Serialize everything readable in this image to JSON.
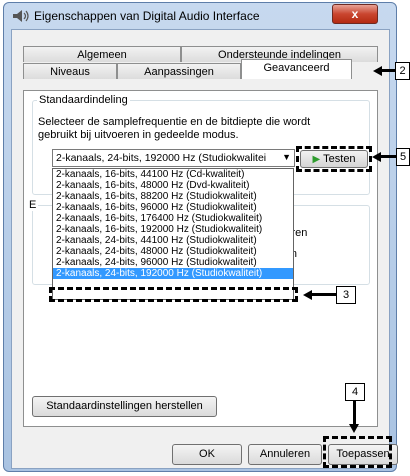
{
  "window": {
    "title": "Eigenschappen van Digital Audio Interface",
    "close_label": "x"
  },
  "tabs": {
    "row1": [
      "Algemeen",
      "Ondersteunde indelingen"
    ],
    "row2": [
      "Niveaus",
      "Aanpassingen",
      "Geavanceerd"
    ],
    "active": "Geavanceerd"
  },
  "default_format": {
    "group_title": "Standaardindeling",
    "description_line1": "Selecteer de samplefrequentie en de bitdiepte die wordt",
    "description_line2": "gebruikt bij uitvoeren in gedeelde modus.",
    "selected_value": "2-kanaals, 24-bits, 192000 Hz (Studiokwalitei",
    "test_button_label": "Testen",
    "options": [
      "2-kanaals, 16-bits, 44100 Hz (Cd-kwaliteit)",
      "2-kanaals, 16-bits, 48000 Hz (Dvd-kwaliteit)",
      "2-kanaals, 16-bits, 88200 Hz (Studiokwaliteit)",
      "2-kanaals, 16-bits, 96000 Hz (Studiokwaliteit)",
      "2-kanaals, 16-bits, 176400 Hz (Studiokwaliteit)",
      "2-kanaals, 16-bits, 192000 Hz (Studiokwaliteit)",
      "2-kanaals, 24-bits, 44100 Hz (Studiokwaliteit)",
      "2-kanaals, 24-bits, 48000 Hz (Studiokwaliteit)",
      "2-kanaals, 24-bits, 96000 Hz (Studiokwaliteit)",
      "2-kanaals, 24-bits, 192000 Hz (Studiokwaliteit)"
    ],
    "selected_option_index": 9
  },
  "exclusive": {
    "group_letter": "E",
    "fragment1": "beheren",
    "fragment2": "geven"
  },
  "restore_defaults_label": "Standaardinstellingen herstellen",
  "footer": {
    "ok_label": "OK",
    "cancel_label": "Annuleren",
    "apply_label": "Toepassen"
  },
  "callouts": {
    "c2": "2",
    "c3": "3",
    "c4": "4",
    "c5": "5"
  },
  "colors": {
    "selection": "#3399ff",
    "close_button": "#c9452f",
    "play_icon": "#2e9c2e"
  }
}
